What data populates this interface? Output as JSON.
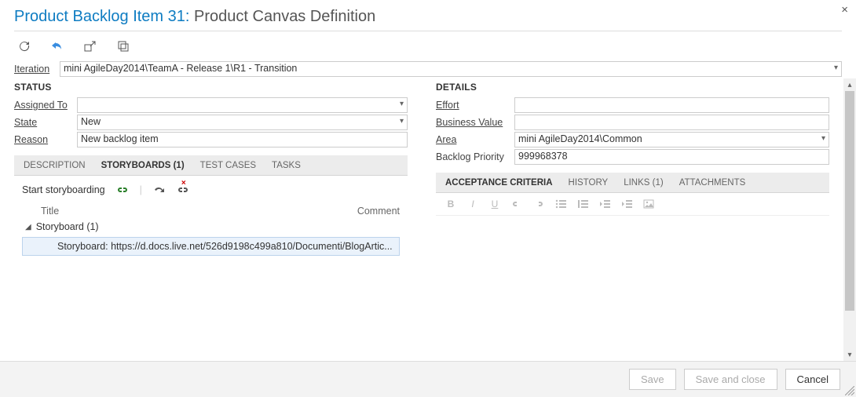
{
  "title": {
    "type_prefix": "Product Backlog Item 31: ",
    "name": "Product Canvas Definition"
  },
  "iteration": {
    "label": "Iteration",
    "value": "mini AgileDay2014\\TeamA - Release 1\\R1 - Transition"
  },
  "status": {
    "heading": "STATUS",
    "assigned_to": {
      "label": "Assigned To",
      "value": ""
    },
    "state": {
      "label": "State",
      "value": "New"
    },
    "reason": {
      "label": "Reason",
      "value": "New backlog item"
    }
  },
  "details": {
    "heading": "DETAILS",
    "effort": {
      "label": "Effort",
      "value": ""
    },
    "business_value": {
      "label": "Business Value",
      "value": ""
    },
    "area": {
      "label": "Area",
      "value": "mini AgileDay2014\\Common"
    },
    "backlog_priority": {
      "label": "Backlog Priority",
      "value": "999968378"
    }
  },
  "left_tabs": {
    "description": "DESCRIPTION",
    "storyboards": "STORYBOARDS (1)",
    "test_cases": "TEST CASES",
    "tasks": "TASKS"
  },
  "right_tabs": {
    "acceptance_criteria": "ACCEPTANCE CRITERIA",
    "history": "HISTORY",
    "links": "LINKS (1)",
    "attachments": "ATTACHMENTS"
  },
  "storyboards": {
    "start_label": "Start storyboarding",
    "columns": {
      "title": "Title",
      "comment": "Comment"
    },
    "group_label": "Storyboard (1)",
    "item_text": "Storyboard: https://d.docs.live.net/526d9198c499a810/Documenti/BlogArtic..."
  },
  "rte": {
    "bold": "B",
    "italic": "I",
    "underline": "U"
  },
  "footer": {
    "save": "Save",
    "save_close": "Save and close",
    "cancel": "Cancel"
  }
}
